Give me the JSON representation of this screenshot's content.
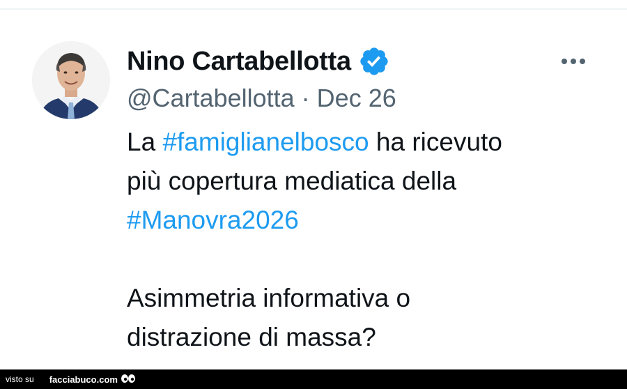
{
  "tweet": {
    "author": {
      "display_name": "Nino Cartabellotta",
      "handle": "@Cartabellotta",
      "verified": true
    },
    "separator": "·",
    "date": "Dec 26",
    "text": {
      "line1_prefix": "La ",
      "hashtag1": "#famiglianelbosco",
      "line1_suffix": " ha ricevuto",
      "line2": "più copertura mediatica della",
      "hashtag2": "#Manovra2026",
      "line3": "Asimmetria informativa o",
      "line4": "distrazione di massa?"
    }
  },
  "footer": {
    "prefix": "visto su",
    "site": "facciabuco.com"
  },
  "colors": {
    "hashtag": "#1d9bf0",
    "verified_badge": "#1d9bf0",
    "text": "#0f1419",
    "secondary_text": "#536471",
    "footer_background": "#000000"
  },
  "icons": {
    "verified": "verified-badge-icon",
    "more": "more-options-icon",
    "footer_logo": "eyes-icon"
  }
}
